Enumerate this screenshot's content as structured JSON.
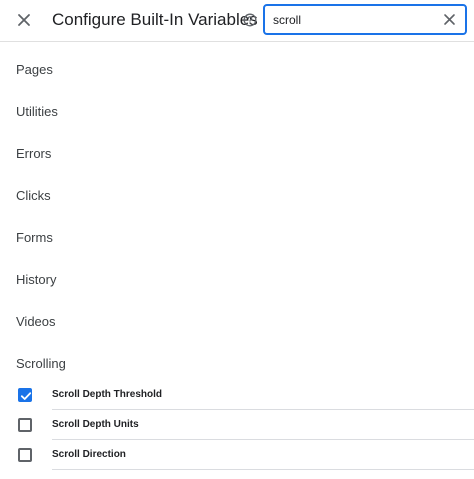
{
  "header": {
    "title": "Configure Built-In Variables"
  },
  "search": {
    "value": "scroll"
  },
  "categories": [
    {
      "label": "Pages"
    },
    {
      "label": "Utilities"
    },
    {
      "label": "Errors"
    },
    {
      "label": "Clicks"
    },
    {
      "label": "Forms"
    },
    {
      "label": "History"
    },
    {
      "label": "Videos"
    },
    {
      "label": "Scrolling"
    }
  ],
  "variables": [
    {
      "label": "Scroll Depth Threshold",
      "checked": true
    },
    {
      "label": "Scroll Depth Units",
      "checked": false
    },
    {
      "label": "Scroll Direction",
      "checked": false
    }
  ],
  "colors": {
    "accent": "#1a73e8",
    "divider": "#dadce0"
  },
  "icons": {
    "close": "close-icon",
    "help": "help-circle-icon",
    "clear": "clear-icon",
    "check": "checkmark-icon"
  }
}
